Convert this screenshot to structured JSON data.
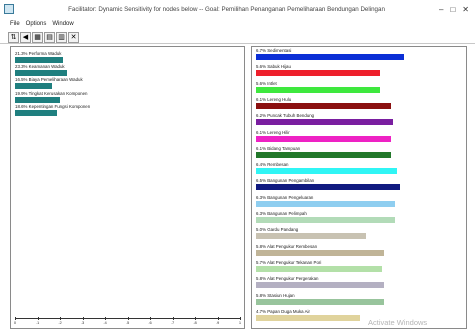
{
  "window": {
    "title": "Facilitator: Dynamic Sensitivity for nodes below -- Goal: Pemilihan Penanganan Pemeliharaan Bendungan Delingan",
    "controls": [
      "–",
      "□",
      "✕"
    ]
  },
  "menu": [
    "File",
    "Options",
    "Window"
  ],
  "toolbar": [
    {
      "name": "graph-icon",
      "glyph": "⇅"
    },
    {
      "name": "nav-left-icon",
      "glyph": "◀"
    },
    {
      "name": "grid-icon",
      "glyph": "▦"
    },
    {
      "name": "table-icon",
      "glyph": "▤"
    },
    {
      "name": "chart-icon",
      "glyph": "▥"
    },
    {
      "name": "close-x-icon",
      "glyph": "✕"
    }
  ],
  "left_panel": {
    "criteria": [
      {
        "label": "21.3% Performa Waduk",
        "value": 21.3,
        "color": "#1f7f7f"
      },
      {
        "label": "23.3% Keamanan Waduk",
        "value": 23.3,
        "color": "#1f7f7f"
      },
      {
        "label": "16.5% Biaya Pemeliharaan Waduk",
        "value": 16.5,
        "color": "#1f7f7f"
      },
      {
        "label": "19.9% Tingkat Kerusakan Komponen",
        "value": 19.9,
        "color": "#1f7f7f"
      },
      {
        "label": "18.6% Kepentingan Fungsi Komponen",
        "value": 18.6,
        "color": "#1f7f7f"
      }
    ],
    "axis_ticks": [
      "0",
      ".1",
      ".2",
      ".3",
      ".4",
      ".5",
      ".6",
      ".7",
      ".8",
      ".9",
      "1"
    ]
  },
  "right_panel": {
    "alternatives": [
      {
        "label": "6.7% Sedimentasi",
        "value": 6.7,
        "color": "#0b2fd6"
      },
      {
        "label": "5.6% Sabuk Hijau",
        "value": 5.6,
        "color": "#ee1f2b"
      },
      {
        "label": "5.6% Intlet",
        "value": 5.6,
        "color": "#3ee83e"
      },
      {
        "label": "6.1% Lereng Hulu",
        "value": 6.1,
        "color": "#8b1010"
      },
      {
        "label": "6.2% Puncak Tubuh Bendung",
        "value": 6.2,
        "color": "#7a1ea0"
      },
      {
        "label": "6.1% Lereng Hilir",
        "value": 6.1,
        "color": "#ee22c4"
      },
      {
        "label": "6.1% Bidang Tampuan",
        "value": 6.1,
        "color": "#22782a"
      },
      {
        "label": "6.4% Rembesan",
        "value": 6.4,
        "color": "#30f5f5"
      },
      {
        "label": "6.5% Bangunan Pengambilan",
        "value": 6.5,
        "color": "#101a80"
      },
      {
        "label": "6.3% Bangunan Pengeluaran",
        "value": 6.3,
        "color": "#8fcef0"
      },
      {
        "label": "6.3% Bangunan Pelimpah",
        "value": 6.3,
        "color": "#b2dbb8"
      },
      {
        "label": "5.0% Gardu Pandang",
        "value": 5.0,
        "color": "#c8c2b2"
      },
      {
        "label": "5.8% Alat Pengukur Rembesan",
        "value": 5.8,
        "color": "#c0b497"
      },
      {
        "label": "5.7% Alat Pengukur Tekanan Pori",
        "value": 5.7,
        "color": "#b3e0a8"
      },
      {
        "label": "5.8% Alat Pengukur Pergerakan",
        "value": 5.8,
        "color": "#b4b0c2"
      },
      {
        "label": "5.8% Stasiun Hujan",
        "value": 5.8,
        "color": "#98c49c"
      },
      {
        "label": "4.7% Papan Duga Muka Air",
        "value": 4.7,
        "color": "#e0d39c"
      }
    ]
  },
  "watermark": "Activate Windows"
}
